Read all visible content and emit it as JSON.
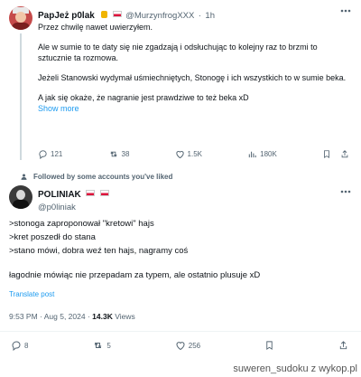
{
  "reply": {
    "author_name": "PapJeż p0lak",
    "handle": "@MurzynfrogXXX",
    "dot": "·",
    "time": "1h",
    "paragraphs": [
      "Przez chwilę nawet uwierzyłem.",
      "Ale w sumie to te daty się nie zgadzają i odsłuchując to kolejny raz to brzmi to sztucznie ta rozmowa.",
      "Jeżeli Stanowski wydymał uśmiechniętych, Stonogę i ich wszystkich to w sumie beka.",
      "A jak się okaże, że nagranie jest prawdziwe to też beka xD"
    ],
    "show_more": "Show more",
    "stats": {
      "replies": "121",
      "reposts": "38",
      "likes": "1.5K",
      "views": "180K"
    }
  },
  "context": {
    "label": "Followed by some accounts you've liked"
  },
  "post": {
    "author_name": "POLINIAK",
    "handle": "@p0liniak",
    "lines": [
      ">stonoga zaproponował \"kretowi\" hajs",
      ">kret poszedł do stana",
      ">stano mówi, dobra weź ten hajs, nagramy coś"
    ],
    "closing": "łagodnie mówiąc nie przepadam za typem, ale ostatnio plusuje xD",
    "translate": "Translate post",
    "time": "9:53 PM · Aug 5, 2024 ·",
    "views_count": "14.3K",
    "views_label": "Views",
    "stats": {
      "replies": "8",
      "reposts": "5",
      "likes": "256"
    }
  },
  "watermark": "suweren_sudoku z wykop.pl",
  "colors": {
    "link": "#1d9bf0",
    "muted": "#536471",
    "divider": "#eff3f4"
  }
}
